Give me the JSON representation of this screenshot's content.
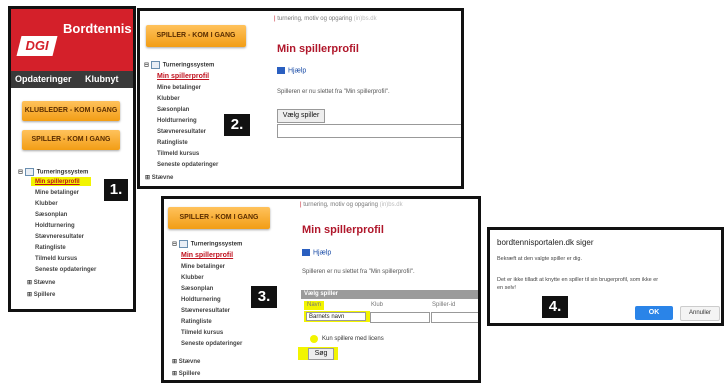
{
  "panel1": {
    "brand": "Bordtennis",
    "logo_text": "DGI",
    "nav": [
      "Opdateringer",
      "Klubnyt"
    ],
    "buttons": [
      "KLUBLEDER - KOM I GANG",
      "SPILLER - KOM I GANG"
    ],
    "menu_header": "Turneringssystem",
    "menu_items": [
      "Min spillerprofil",
      "Mine betalinger",
      "Klubber",
      "Sæsonplan",
      "Holdturnering",
      "Stævneresultater",
      "Ratingliste",
      "Tilmeld kursus",
      "Seneste opdateringer"
    ],
    "menu_extra": [
      "⊞ Stævne",
      "⊞ Spillere"
    ],
    "badge": "1."
  },
  "panel2": {
    "button": "SPILLER - KOM I GANG",
    "breadcrumb": {
      "sep": "|",
      "text": "turnering, motiv og opgaring",
      "extra": "(in)bs.dk"
    },
    "title": "Min spillerprofil",
    "help": "Hjælp",
    "message": "Spilleren er nu slettet fra \"Min spillerprofil\".",
    "select_button": "Vælg spiller",
    "menu_header": "Turneringssystem",
    "menu_items": [
      "Min spillerprofil",
      "Mine betalinger",
      "Klubber",
      "Sæsonplan",
      "Holdturnering",
      "Stævneresultater",
      "Ratingliste",
      "Tilmeld kursus",
      "Seneste opdateringer",
      "⊞ Stævne"
    ],
    "badge": "2."
  },
  "panel3": {
    "button": "SPILLER - KOM I GANG",
    "breadcrumb": {
      "sep": "|",
      "text": "turnering, motiv og opgaring",
      "extra": "(in)bs.dk"
    },
    "title": "Min spillerprofil",
    "help": "Hjælp",
    "message": "Spilleren er nu slettet fra \"Min spillerprofil\".",
    "form_header": "Vælg spiller",
    "columns": [
      "Navn",
      "Klub",
      "Spiller-id"
    ],
    "name_value": "Barnets navn",
    "checkbox_label": "Kun spillere med licens",
    "search_button": "Søg",
    "menu_header": "Turneringssystem",
    "menu_items": [
      "Min spillerprofil",
      "Mine betalinger",
      "Klubber",
      "Sæsonplan",
      "Holdturnering",
      "Stævneresultater",
      "Ratingliste",
      "Tilmeld kursus",
      "Seneste opdateringer"
    ],
    "menu_extra": [
      "⊞ Stævne",
      "⊞ Spillere"
    ],
    "badge": "3."
  },
  "panel4": {
    "title": "bordtennisportalen.dk siger",
    "line1": "Bekræft at den valgte spiller er dig.",
    "line2": "Det er ikke tilladt at knytte en spiller til sin brugerprofil, som ikke er",
    "line3": "en selv!",
    "ok": "OK",
    "cancel": "Annuller",
    "badge": "4."
  },
  "colors": {
    "brand_red": "#d4202a",
    "title_red": "#b0172b",
    "orange": "#f29d15",
    "highlight": "#f2f400",
    "ok_blue": "#2a84e8"
  }
}
